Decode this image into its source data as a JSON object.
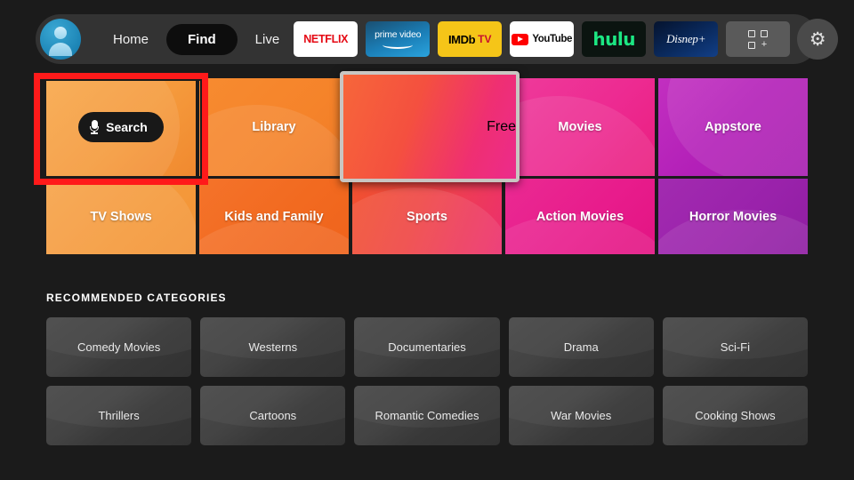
{
  "nav": {
    "avatar_name": "profile-avatar",
    "links": [
      {
        "label": "Home",
        "active": false
      },
      {
        "label": "Find",
        "active": true
      },
      {
        "label": "Live",
        "active": false
      }
    ],
    "apps": [
      {
        "name": "netflix",
        "label": "NETFLIX"
      },
      {
        "name": "prime-video",
        "label": "prime video"
      },
      {
        "name": "imdb-tv",
        "label": "IMDb",
        "sub": "TV"
      },
      {
        "name": "youtube",
        "label": "YouTube"
      },
      {
        "name": "hulu",
        "label": "hulu"
      },
      {
        "name": "disney-plus",
        "label": "Disnep+"
      }
    ],
    "grid_button": "apps-grid-add",
    "settings_button": "settings-gear"
  },
  "hero": {
    "search": {
      "label": "Search",
      "icon": "microphone-icon"
    },
    "tiles_row1": [
      {
        "label": "Library",
        "color": "#f5832a"
      },
      {
        "label": "Free",
        "color": "#f75a3c"
      },
      {
        "label": "Movies",
        "color": "#ed2a91"
      },
      {
        "label": "Appstore",
        "color": "#b320b8"
      }
    ],
    "tiles_row2": [
      {
        "label": "TV Shows",
        "color": "#f59a3c"
      },
      {
        "label": "Kids and Family",
        "color": "#f26a20"
      },
      {
        "label": "Sports",
        "color": "#ef4545"
      },
      {
        "label": "Action Movies",
        "color": "#e81c8c"
      },
      {
        "label": "Horror Movies",
        "color": "#9a22ab"
      }
    ],
    "focused_tile": "Free",
    "annotated_tile": "Search"
  },
  "recommended": {
    "title": "RECOMMENDED CATEGORIES",
    "row1": [
      "Comedy Movies",
      "Westerns",
      "Documentaries",
      "Drama",
      "Sci-Fi"
    ],
    "row2": [
      "Thrillers",
      "Cartoons",
      "Romantic Comedies",
      "War Movies",
      "Cooking Shows"
    ]
  },
  "colors": {
    "background": "#1b1b1b",
    "navbar": "#333333",
    "annotation": "#ff1a1a",
    "focus_ring": "#c9c6c2"
  }
}
